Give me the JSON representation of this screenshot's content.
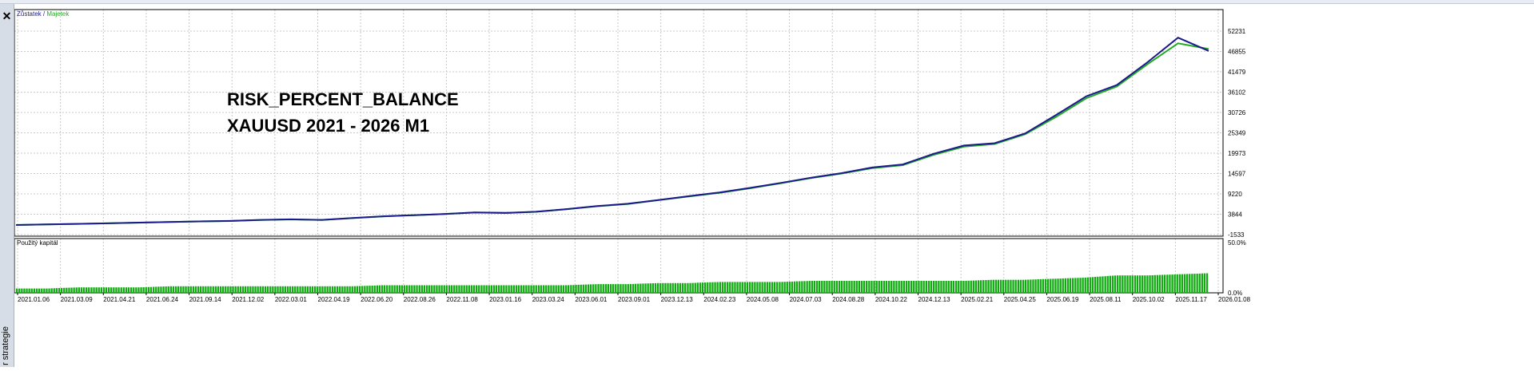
{
  "side_panel": {
    "label": "r strategie",
    "close_glyph": "✕"
  },
  "main_legend": {
    "balance_label": "Zůstatek",
    "separator": " / ",
    "equity_label": "Majetek"
  },
  "overlay_text": {
    "line1": "RISK_PERCENT_BALANCE",
    "line2": "XAUUSD 2021 - 2026 M1"
  },
  "sub_legend": {
    "label": "Použitý kapitál"
  },
  "colors": {
    "balance": "#1a1a8c",
    "equity": "#22aa22",
    "volume": "#11aa11",
    "grid": "#c8c8c8",
    "axis_text": "#000000"
  },
  "chart_data": [
    {
      "type": "line",
      "series": [
        {
          "name": "Zůstatek",
          "values": [
            1000,
            1150,
            1300,
            1450,
            1620,
            1800,
            1950,
            2080,
            2350,
            2500,
            2350,
            2850,
            3300,
            3600,
            3900,
            4300,
            4200,
            4500,
            5200,
            6000,
            6600,
            7600,
            8600,
            9600,
            10800,
            12100,
            13500,
            14700,
            16200,
            17000,
            19800,
            22000,
            22600,
            25200,
            30000,
            35000,
            38000,
            44000,
            50500,
            47000
          ]
        },
        {
          "name": "Majetek",
          "values": [
            1000,
            1150,
            1300,
            1450,
            1600,
            1780,
            1950,
            2060,
            2330,
            2480,
            2330,
            2820,
            3250,
            3580,
            3880,
            4280,
            4150,
            4470,
            5150,
            5950,
            6550,
            7550,
            8550,
            9500,
            10700,
            12000,
            13400,
            14600,
            16000,
            16800,
            19500,
            21700,
            22400,
            25000,
            29500,
            34500,
            37600,
            43500,
            49000,
            47500
          ]
        }
      ],
      "y_ticks": [
        "52231",
        "46855",
        "41479",
        "36102",
        "30726",
        "25349",
        "19973",
        "14597",
        "9220",
        "3844",
        "-1533"
      ],
      "ylim": [
        -1533,
        52231
      ],
      "grid": true
    },
    {
      "type": "bar",
      "title": "Použitý kapitál",
      "series": [
        {
          "name": "Použitý kapitál",
          "values": [
            4,
            4,
            5,
            5,
            5,
            6,
            6,
            6,
            6,
            6,
            6,
            6,
            7,
            7,
            7,
            7,
            7,
            7,
            7,
            8,
            8,
            9,
            9,
            10,
            10,
            10,
            11,
            11,
            11,
            11,
            11,
            11,
            12,
            12,
            13,
            14,
            16,
            16,
            17,
            18
          ]
        }
      ],
      "y_ticks": [
        "50.0%",
        "0.0%"
      ],
      "ylim": [
        0,
        50
      ],
      "x_ticks": [
        "2021.01.06",
        "2021.03.09",
        "2021.04.21",
        "2021.06.24",
        "2021.09.14",
        "2021.12.02",
        "2022.03.01",
        "2022.04.19",
        "2022.06.20",
        "2022.08.26",
        "2022.11.08",
        "2023.01.16",
        "2023.03.24",
        "2023.06.01",
        "2023.09.01",
        "2023.12.13",
        "2024.02.23",
        "2024.05.08",
        "2024.07.03",
        "2024.08.28",
        "2024.10.22",
        "2024.12.13",
        "2025.02.21",
        "2025.04.25",
        "2025.06.19",
        "2025.08.11",
        "2025.10.02",
        "2025.11.17",
        "2026.01.08"
      ],
      "grid": true
    }
  ]
}
